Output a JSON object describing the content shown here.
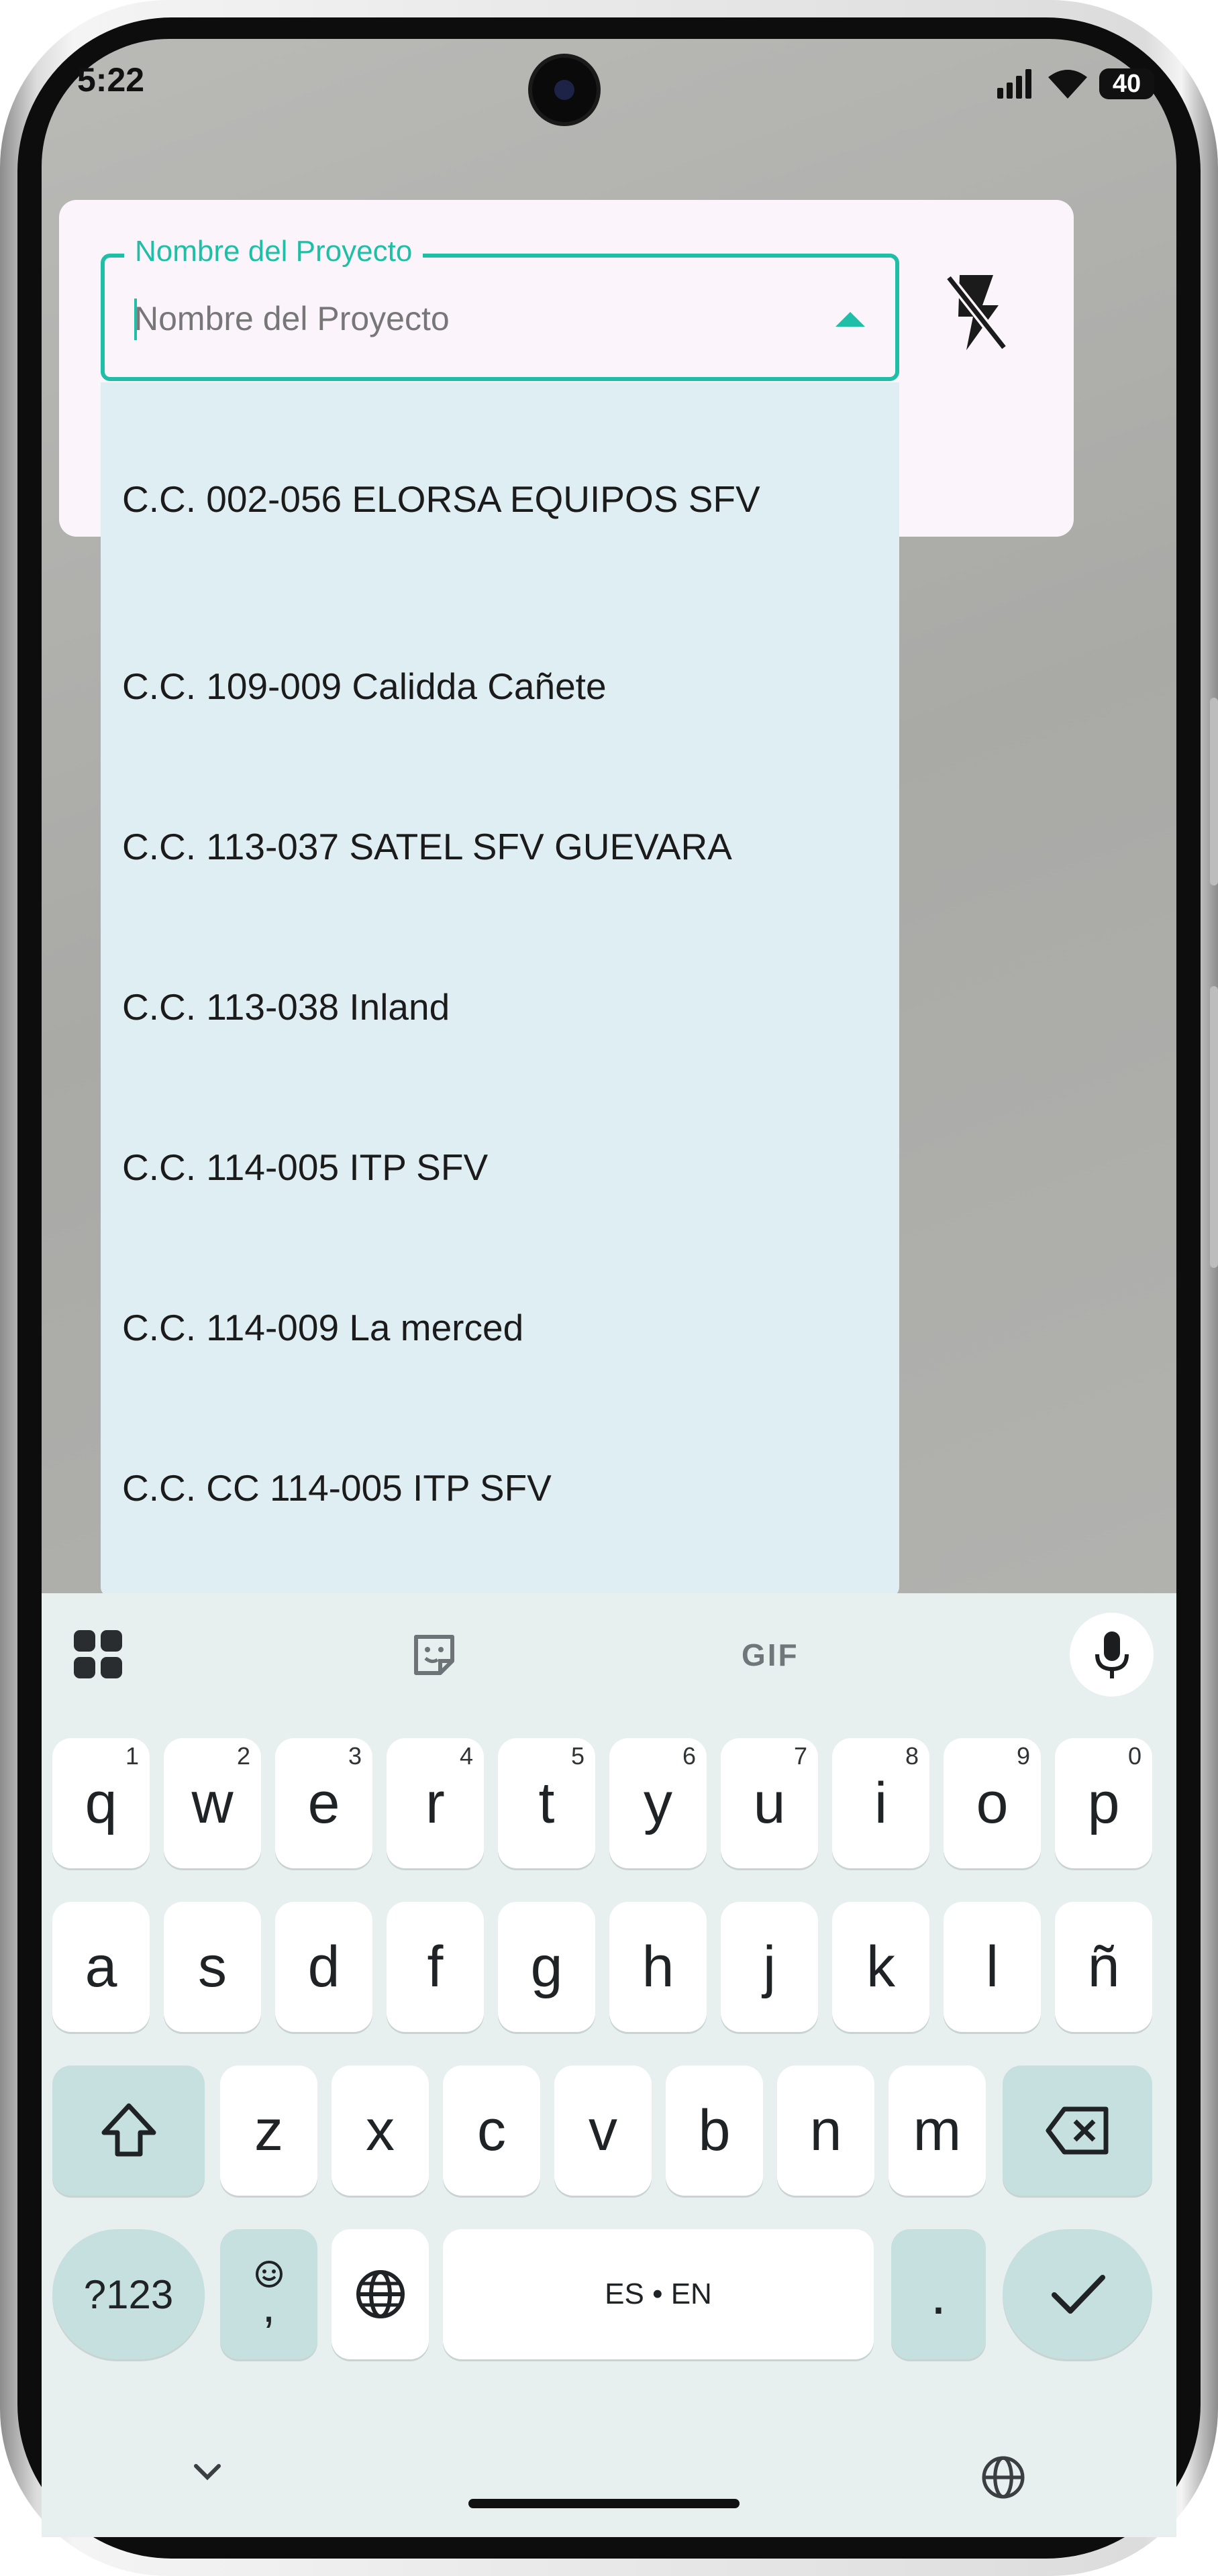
{
  "status_bar": {
    "time": "5:22",
    "battery": "40"
  },
  "project_field": {
    "label": "Nombre del Proyecto",
    "placeholder": "Nombre del Proyecto",
    "value": ""
  },
  "dropdown": {
    "options": [
      "C.C. 002-056 ELORSA EQUIPOS SFV",
      "C.C. 109-009 Calidda Cañete",
      "C.C. 113-037 SATEL SFV GUEVARA",
      "C.C. 113-038 Inland",
      "C.C. 114-005 ITP SFV",
      "C.C. 114-009 La merced",
      "C.C. CC 114-005 ITP SFV"
    ]
  },
  "keyboard": {
    "toolbar": {
      "gif": "GIF"
    },
    "row1": [
      {
        "k": "q",
        "h": "1"
      },
      {
        "k": "w",
        "h": "2"
      },
      {
        "k": "e",
        "h": "3"
      },
      {
        "k": "r",
        "h": "4"
      },
      {
        "k": "t",
        "h": "5"
      },
      {
        "k": "y",
        "h": "6"
      },
      {
        "k": "u",
        "h": "7"
      },
      {
        "k": "i",
        "h": "8"
      },
      {
        "k": "o",
        "h": "9"
      },
      {
        "k": "p",
        "h": "0"
      }
    ],
    "row2": [
      "a",
      "s",
      "d",
      "f",
      "g",
      "h",
      "j",
      "k",
      "l",
      "ñ"
    ],
    "row3": [
      "z",
      "x",
      "c",
      "v",
      "b",
      "n",
      "m"
    ],
    "symbols_label": "?123",
    "comma_label": ",",
    "space_label": "ES • EN",
    "period_label": "."
  },
  "colors": {
    "accent": "#1ebfa6",
    "dropdown_bg": "#dfeef2",
    "card_bg": "#fbf4fb",
    "keyboard_bg": "#e7f0ef"
  }
}
